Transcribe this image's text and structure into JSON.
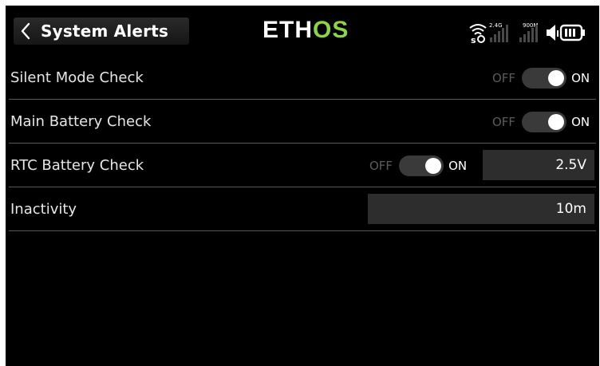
{
  "header": {
    "title": "System Alerts",
    "logo_left": "ETH",
    "logo_right": "OS",
    "signal_24": "2.4G",
    "signal_900": "900M",
    "icons": [
      "back-chevron-icon",
      "rf-signal-icon",
      "signal-bars-icon",
      "speaker-icon",
      "battery-icon"
    ]
  },
  "rows": [
    {
      "label": "Silent Mode Check",
      "off": "OFF",
      "on": "ON",
      "state": "ON"
    },
    {
      "label": "Main Battery Check",
      "off": "OFF",
      "on": "ON",
      "state": "ON"
    },
    {
      "label": "RTC Battery Check",
      "off": "OFF",
      "on": "ON",
      "state": "ON",
      "value": "2.5V"
    },
    {
      "label": "Inactivity",
      "value": "10m"
    }
  ],
  "colors": {
    "accent": "#8ed44a",
    "background": "#000000",
    "field": "#2d2d2d"
  }
}
